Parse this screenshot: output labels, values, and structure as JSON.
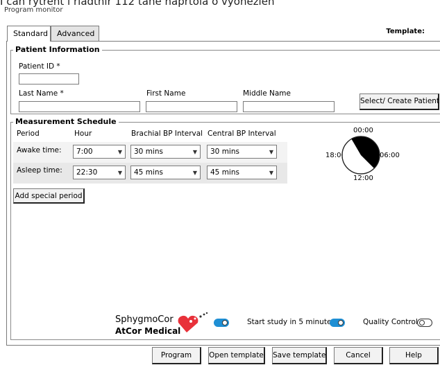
{
  "header": {
    "cutoff_text": "I can rytrent i riadtnir 112 tane naprtola o vyonezlen",
    "window_title": "Program monitor"
  },
  "tabs": [
    {
      "label": "Standard"
    },
    {
      "label": "Advanced"
    }
  ],
  "template_label": "Template:",
  "patient": {
    "section_title": "Patient Information",
    "patient_id_label": "Patient ID *",
    "last_name_label": "Last Name *",
    "first_name_label": "First Name",
    "middle_name_label": "Middle Name",
    "patient_id_value": "",
    "last_name_value": "",
    "first_name_value": "",
    "middle_name_value": "",
    "select_button": "Select/ Create Patient"
  },
  "schedule": {
    "section_title": "Measurement Schedule",
    "columns": [
      "Period",
      "Hour",
      "Brachial BP Interval",
      "Central BP Interval"
    ],
    "rows": [
      {
        "period": "Awake time:",
        "hour": "7:00",
        "brachial": "30 mins",
        "central": "30 mins"
      },
      {
        "period": "Asleep time:",
        "hour": "22:30",
        "brachial": "45 mins",
        "central": "45 mins"
      }
    ],
    "add_special_button": "Add special period",
    "clock": {
      "top": "00:00",
      "right": "06:00",
      "bottom": "12:00",
      "left": "18:00"
    }
  },
  "footer": {
    "logo_line1": "SphygmoCor",
    "logo_line2": "AtCor Medical",
    "start_study_label": "Start study in 5 minutes",
    "start_study_on": true,
    "logo_toggle_on": true,
    "quality_control_label": "Quality Control",
    "quality_control_on": false
  },
  "buttons": {
    "program": "Program",
    "open_template": "Open template",
    "save_template": "Save template",
    "cancel": "Cancel",
    "help": "Help"
  },
  "colors": {
    "toggle_on": "#1f8fd4",
    "logo_red": "#e8313a",
    "logo_text": "#000000"
  },
  "icons": [
    "chevron-down-icon",
    "clock-icon",
    "toggle-icon",
    "sphygmocor-logo-icon"
  ]
}
